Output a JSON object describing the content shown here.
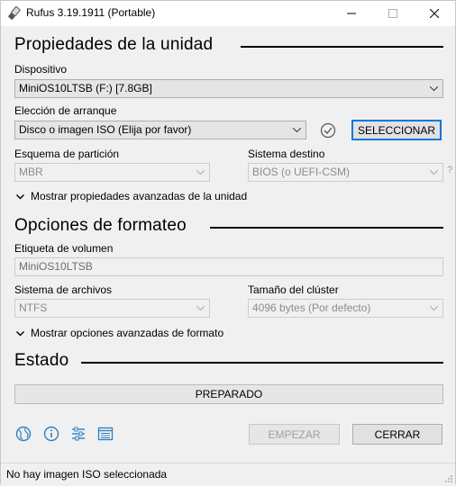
{
  "window": {
    "title": "Rufus 3.19.1911 (Portable)"
  },
  "drive_properties": {
    "heading": "Propiedades de la unidad",
    "device_label": "Dispositivo",
    "device_value": "MiniOS10LTSB (F:) [7.8GB]",
    "boot_label": "Elección de arranque",
    "boot_value": "Disco o imagen ISO (Elija por favor)",
    "select_button": "SELECCIONAR",
    "partition_label": "Esquema de partición",
    "partition_value": "MBR",
    "target_label": "Sistema destino",
    "target_value": "BIOS (o UEFI-CSM)",
    "help_glyph": "?",
    "advanced_toggle": "Mostrar propiedades avanzadas de la unidad"
  },
  "format_options": {
    "heading": "Opciones de formateo",
    "volume_label": "Etiqueta de volumen",
    "volume_value": "MiniOS10LTSB",
    "filesystem_label": "Sistema de archivos",
    "filesystem_value": "NTFS",
    "cluster_label": "Tamaño del clúster",
    "cluster_value": "4096 bytes (Por defecto)",
    "advanced_toggle": "Mostrar opciones avanzadas de formato"
  },
  "status": {
    "heading": "Estado",
    "progress_text": "PREPARADO",
    "start_button": "EMPEZAR",
    "close_button": "CERRAR",
    "statusbar_text": "No hay imagen ISO seleccionada"
  },
  "toolbar": {
    "icons": [
      "globe-icon",
      "info-icon",
      "settings-sliders-icon",
      "log-icon"
    ]
  },
  "colors": {
    "accent": "#0078d7",
    "icon_blue": "#2f7fc1"
  }
}
